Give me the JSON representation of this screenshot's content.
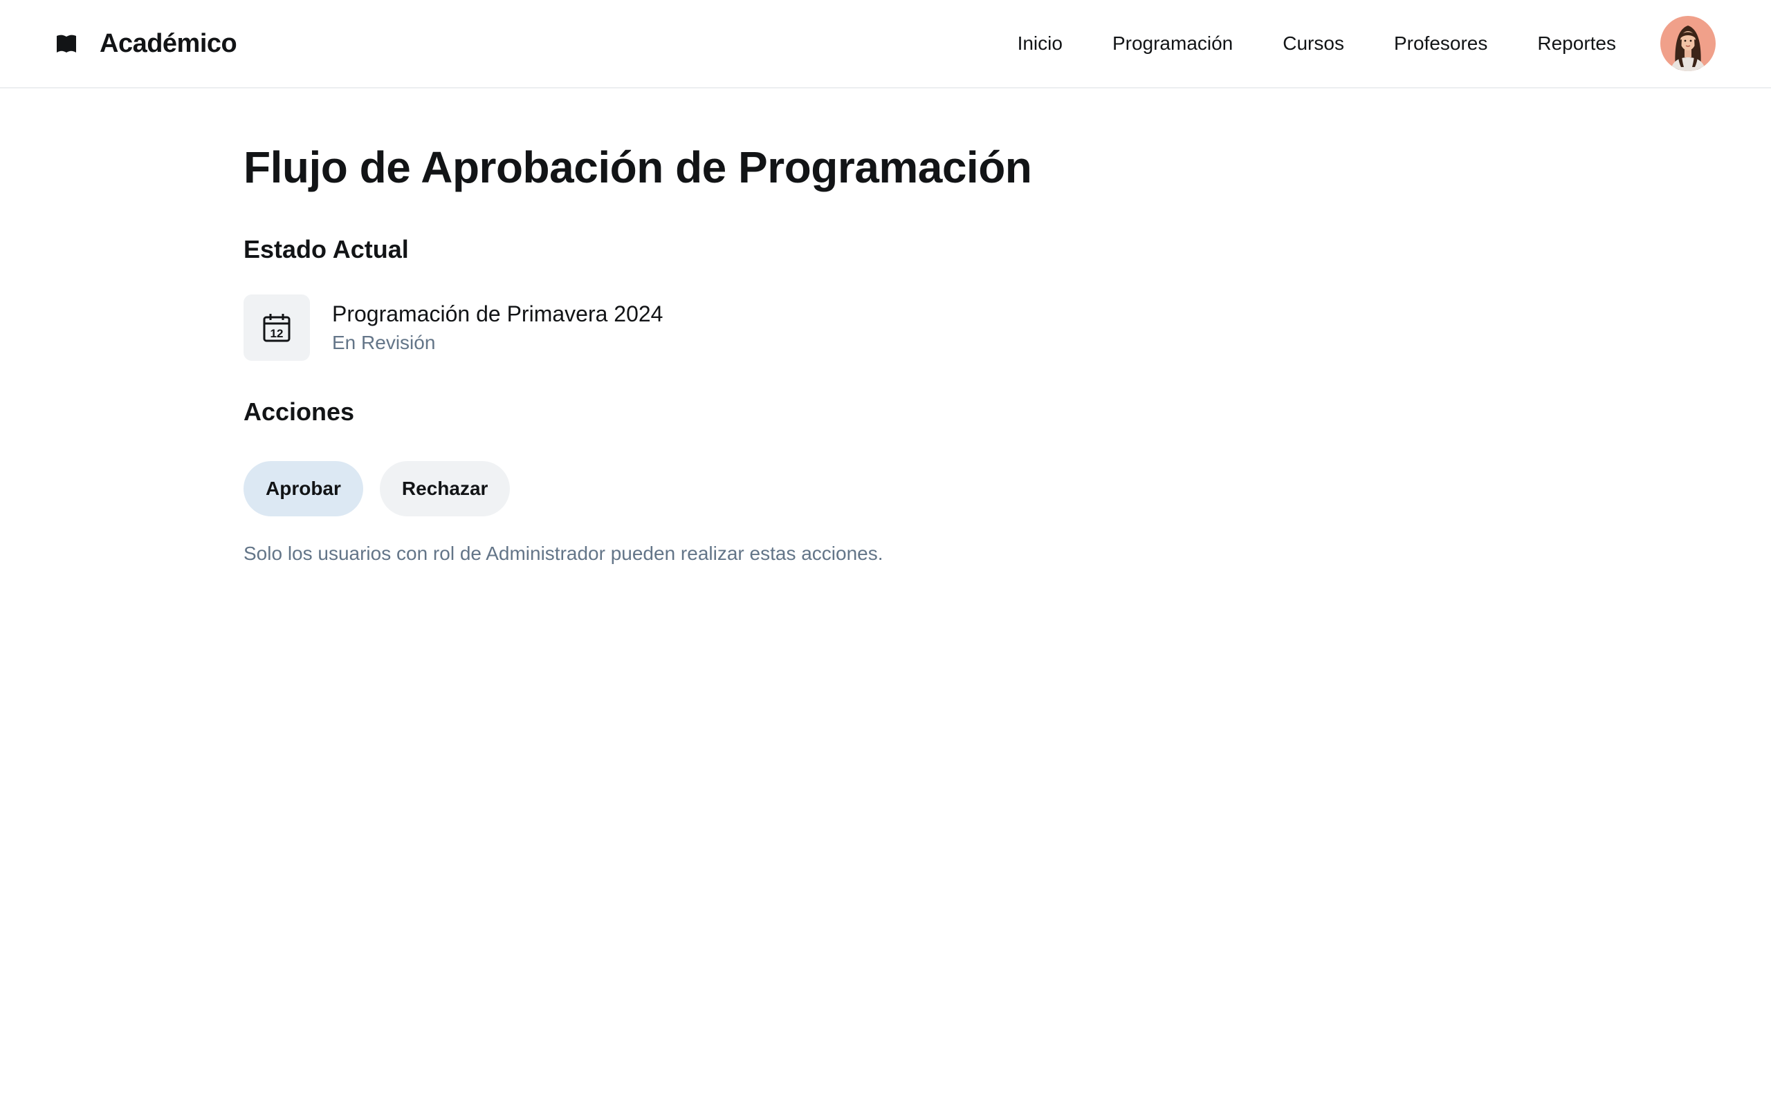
{
  "header": {
    "app_title": "Académico",
    "logo_icon": "book-icon",
    "nav": [
      {
        "label": "Inicio"
      },
      {
        "label": "Programación"
      },
      {
        "label": "Cursos"
      },
      {
        "label": "Profesores"
      },
      {
        "label": "Reportes"
      }
    ],
    "avatar_icon": "user-avatar"
  },
  "main": {
    "title": "Flujo de Aprobación de Programación",
    "status_section": {
      "heading": "Estado Actual",
      "icon": "calendar-icon",
      "icon_day": "12",
      "schedule_name": "Programación de Primavera 2024",
      "state": "En Revisión"
    },
    "actions_section": {
      "heading": "Acciones",
      "approve_label": "Aprobar",
      "reject_label": "Rechazar",
      "note": "Solo los usuarios con rol de Administrador pueden realizar estas acciones."
    }
  },
  "colors": {
    "approve_bg": "#dce8f3",
    "reject_bg": "#f0f2f4",
    "muted_text": "#637588",
    "avatar_bg": "#f0a08a"
  }
}
